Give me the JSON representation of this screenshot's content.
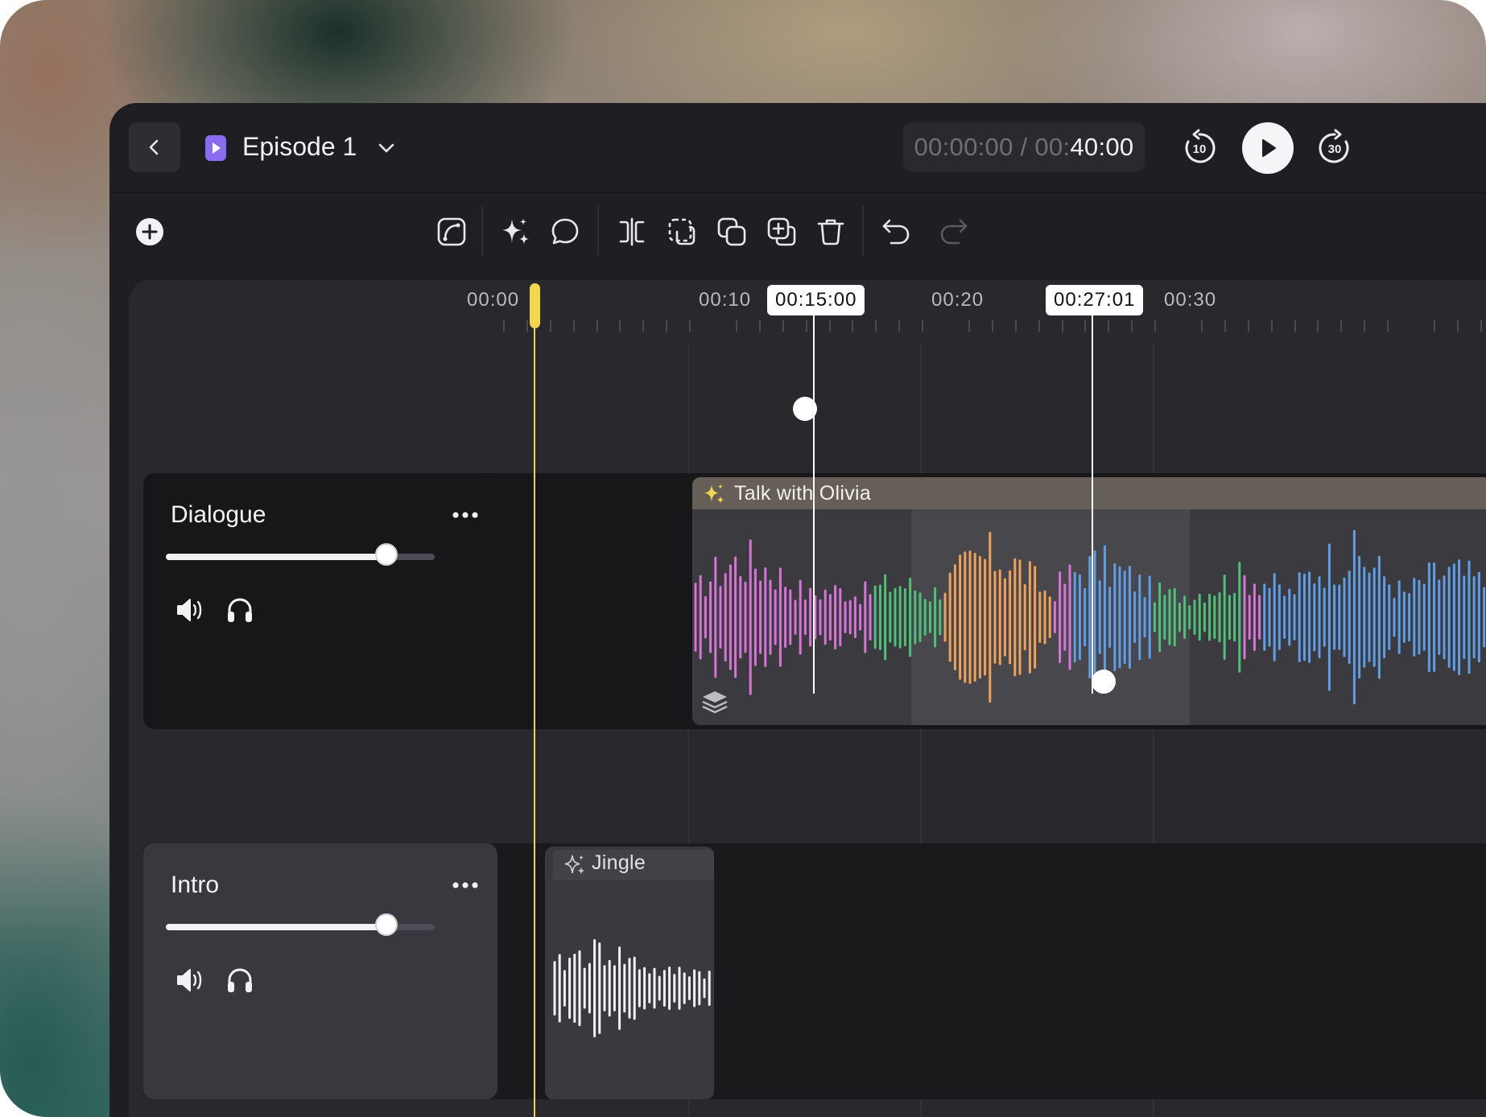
{
  "header": {
    "project_title": "Episode 1",
    "timecode": {
      "current": "00:00:00",
      "separator": " / ",
      "total_dim": "00:",
      "total_bright": "40:00"
    },
    "rewind_seconds": "10",
    "forward_seconds": "30"
  },
  "toolbar": {
    "tools": [
      "curve-tool-icon",
      "magic-sparkle-icon",
      "comment-icon",
      "split-icon",
      "select-region-icon",
      "duplicate-icon",
      "add-copy-icon",
      "trash-icon",
      "undo-icon",
      "redo-icon"
    ]
  },
  "ruler": {
    "labels": [
      "00:00",
      "00:10",
      "00:20",
      "00:30"
    ],
    "markers": [
      "00:15:00",
      "00:27:01"
    ]
  },
  "tracks": [
    {
      "name": "Dialogue",
      "volume": 0.82,
      "clip_title": "Talk with Olivia"
    },
    {
      "name": "Intro",
      "volume": 0.82,
      "clip_title": "Jingle"
    }
  ],
  "colors": {
    "playhead": "#f4d64c",
    "wave_pink": "#d873d8",
    "wave_green": "#4fc07a",
    "wave_orange": "#f0a25a",
    "wave_blue": "#5f9ee6",
    "accent_purple": "#8a6cf0"
  }
}
